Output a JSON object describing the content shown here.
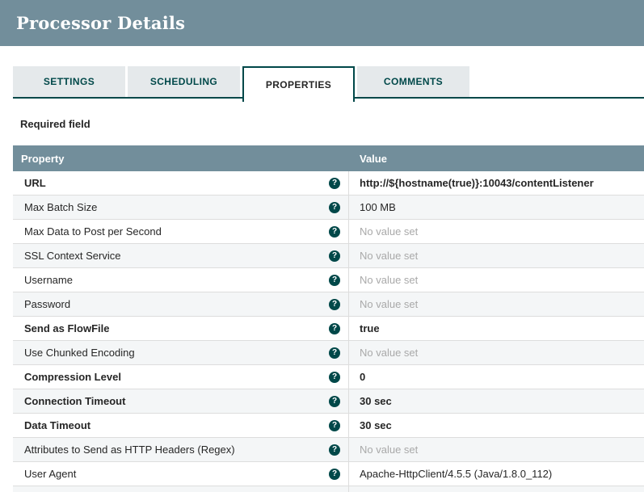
{
  "header": {
    "title": "Processor Details"
  },
  "tabs": [
    {
      "label": "SETTINGS"
    },
    {
      "label": "SCHEDULING"
    },
    {
      "label": "PROPERTIES"
    },
    {
      "label": "COMMENTS"
    }
  ],
  "active_tab": "PROPERTIES",
  "required_field_note": "Required field",
  "colors": {
    "titlebar_bg": "#728e9b",
    "table_header_bg": "#728e9b",
    "accent_teal": "#004849",
    "inactive_tab_bg": "#e5e9eb",
    "alt_row_bg": "#f4f6f7",
    "unset_text": "#a9a9a9"
  },
  "table": {
    "columns": [
      "Property",
      "Value"
    ],
    "help_icon_glyph": "?",
    "rows": [
      {
        "property": "URL",
        "value": "http://${hostname(true)}:10043/contentListener",
        "required": true,
        "value_set": true
      },
      {
        "property": "Max Batch Size",
        "value": "100 MB",
        "required": false,
        "value_set": true
      },
      {
        "property": "Max Data to Post per Second",
        "value": "No value set",
        "required": false,
        "value_set": false
      },
      {
        "property": "SSL Context Service",
        "value": "No value set",
        "required": false,
        "value_set": false
      },
      {
        "property": "Username",
        "value": "No value set",
        "required": false,
        "value_set": false
      },
      {
        "property": "Password",
        "value": "No value set",
        "required": false,
        "value_set": false
      },
      {
        "property": "Send as FlowFile",
        "value": "true",
        "required": true,
        "value_set": true
      },
      {
        "property": "Use Chunked Encoding",
        "value": "No value set",
        "required": false,
        "value_set": false
      },
      {
        "property": "Compression Level",
        "value": "0",
        "required": true,
        "value_set": true
      },
      {
        "property": "Connection Timeout",
        "value": "30 sec",
        "required": true,
        "value_set": true
      },
      {
        "property": "Data Timeout",
        "value": "30 sec",
        "required": true,
        "value_set": true
      },
      {
        "property": "Attributes to Send as HTTP Headers (Regex)",
        "value": "No value set",
        "required": false,
        "value_set": false
      },
      {
        "property": "User Agent",
        "value": "Apache-HttpClient/4.5.5 (Java/1.8.0_112)",
        "required": false,
        "value_set": true
      }
    ]
  }
}
